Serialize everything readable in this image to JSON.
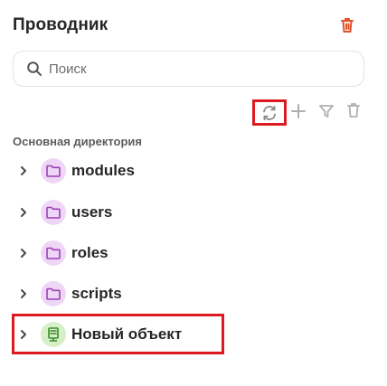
{
  "panel": {
    "title": "Проводник"
  },
  "search": {
    "placeholder": "Поиск",
    "value": ""
  },
  "toolbar": {
    "icons": [
      "refresh-icon",
      "plus-icon",
      "filter-icon",
      "trash-icon"
    ]
  },
  "tree": {
    "section_label": "Основная директория",
    "items": [
      {
        "label": "modules",
        "icon": "folder-icon",
        "expanded": false
      },
      {
        "label": "users",
        "icon": "folder-icon",
        "expanded": false
      },
      {
        "label": "roles",
        "icon": "folder-icon",
        "expanded": false
      },
      {
        "label": "scripts",
        "icon": "folder-icon",
        "expanded": false
      },
      {
        "label": "Новый объект",
        "icon": "object-icon",
        "expanded": false
      }
    ]
  },
  "colors": {
    "accent_red": "#dd1a22",
    "header_trash": "#e2522a",
    "folder_bg": "#eed6f6",
    "folder_stroke": "#9b3fb5",
    "object_bg": "#d6efc8",
    "object_stroke": "#3a8a2a",
    "muted_icon": "#b0b0b0"
  }
}
